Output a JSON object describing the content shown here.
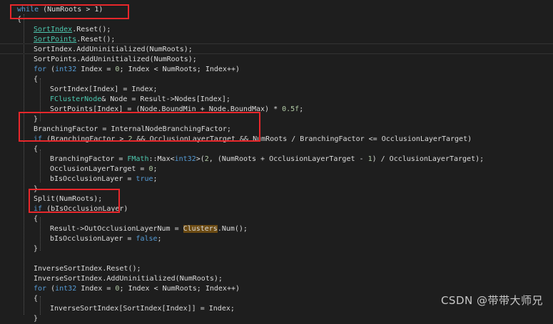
{
  "colors": {
    "background": "#1e1e1e",
    "text": "#dcdcdc",
    "keyword": "#569cd6",
    "type": "#4ec9b0",
    "number": "#b5cea8",
    "highlight": "#6b4a12",
    "annotation_box": "#e8272b"
  },
  "code_lines": [
    [
      {
        "t": "while",
        "c": "kw"
      },
      {
        "t": " (NumRoots > 1)"
      }
    ],
    [
      {
        "t": "{"
      }
    ],
    [
      {
        "t": "SortIndex",
        "c": "ty ul"
      },
      {
        "t": ".Reset();"
      }
    ],
    [
      {
        "t": "SortPoints",
        "c": "ty ul"
      },
      {
        "t": ".Reset();"
      }
    ],
    [
      {
        "t": "SortIndex.AddUninitialized(NumRoots);"
      }
    ],
    [
      {
        "t": "SortPoints.AddUninitialized(NumRoots);"
      }
    ],
    [
      {
        "t": "for",
        "c": "kw"
      },
      {
        "t": " ("
      },
      {
        "t": "int32",
        "c": "kw"
      },
      {
        "t": " Index = "
      },
      {
        "t": "0",
        "c": "nu"
      },
      {
        "t": "; Index < NumRoots; Index++)"
      }
    ],
    [
      {
        "t": "{"
      }
    ],
    [
      {
        "t": "SortIndex[Index] = Index;"
      }
    ],
    [
      {
        "t": "FClusterNode",
        "c": "ty"
      },
      {
        "t": "& Node = Result->Nodes[Index];"
      }
    ],
    [
      {
        "t": "SortPoints[Index] = (Node.BoundMin + Node.BoundMax) * "
      },
      {
        "t": "0.5f",
        "c": "nu"
      },
      {
        "t": ";"
      }
    ],
    [
      {
        "t": "}"
      }
    ],
    [
      {
        "t": "BranchingFactor = InternalNodeBranchingFactor;"
      }
    ],
    [
      {
        "t": "if",
        "c": "kw"
      },
      {
        "t": " (BranchingFactor > "
      },
      {
        "t": "2",
        "c": "nu"
      },
      {
        "t": " && OcclusionLayerTarget && NumRoots / BranchingFactor <= OcclusionLayerTarget)"
      }
    ],
    [
      {
        "t": "{"
      }
    ],
    [
      {
        "t": "BranchingFactor = "
      },
      {
        "t": "FMath",
        "c": "ty"
      },
      {
        "t": "::Max<"
      },
      {
        "t": "int32",
        "c": "kw"
      },
      {
        "t": ">("
      },
      {
        "t": "2",
        "c": "nu"
      },
      {
        "t": ", (NumRoots + OcclusionLayerTarget - "
      },
      {
        "t": "1",
        "c": "nu"
      },
      {
        "t": ") / OcclusionLayerTarget);"
      }
    ],
    [
      {
        "t": "OcclusionLayerTarget = "
      },
      {
        "t": "0",
        "c": "nu"
      },
      {
        "t": ";"
      }
    ],
    [
      {
        "t": "bIsOcclusionLayer = "
      },
      {
        "t": "true",
        "c": "kw"
      },
      {
        "t": ";"
      }
    ],
    [
      {
        "t": "}"
      }
    ],
    [
      {
        "t": "Split(NumRoots);"
      }
    ],
    [
      {
        "t": "if",
        "c": "kw"
      },
      {
        "t": " (bIsOcclusionLayer)"
      }
    ],
    [
      {
        "t": "{"
      }
    ],
    [
      {
        "t": "Result->OutOcclusionLayerNum = "
      },
      {
        "t": "Clusters",
        "c": "hl"
      },
      {
        "t": ".Num();"
      }
    ],
    [
      {
        "t": "bIsOcclusionLayer = "
      },
      {
        "t": "false",
        "c": "kw"
      },
      {
        "t": ";"
      }
    ],
    [
      {
        "t": "}"
      }
    ],
    [
      {
        "t": ""
      }
    ],
    [
      {
        "t": "InverseSortIndex.Reset();"
      }
    ],
    [
      {
        "t": "InverseSortIndex.AddUninitialized(NumRoots);"
      }
    ],
    [
      {
        "t": "for",
        "c": "kw"
      },
      {
        "t": " ("
      },
      {
        "t": "int32",
        "c": "kw"
      },
      {
        "t": " Index = "
      },
      {
        "t": "0",
        "c": "nu"
      },
      {
        "t": "; Index < NumRoots; Index++)"
      }
    ],
    [
      {
        "t": "{"
      }
    ],
    [
      {
        "t": "InverseSortIndex[SortIndex[Index]] = Index;"
      }
    ],
    [
      {
        "t": "}"
      }
    ]
  ],
  "watermark": "CSDN @带带大师兄"
}
